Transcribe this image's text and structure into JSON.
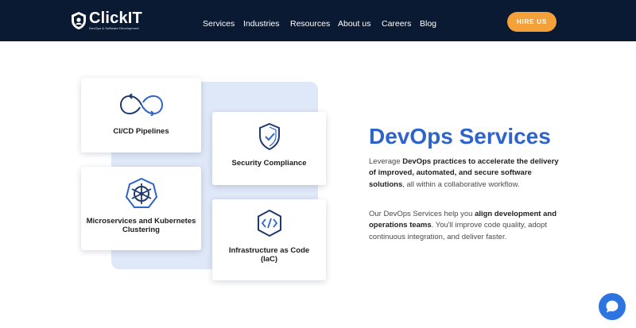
{
  "header": {
    "logo_text": "ClickIT",
    "logo_subtitle": "DevOps & Software Development",
    "nav": [
      "Services",
      "Industries",
      "Resources",
      "About us",
      "Careers",
      "Blog"
    ],
    "hire_label": "HIRE US"
  },
  "cards": [
    {
      "label": "CI/CD Pipelines",
      "icon": "infinity-icon"
    },
    {
      "label": "Security Compliance",
      "icon": "shield-check-icon"
    },
    {
      "label": "Microservices and Kubernetes Clustering",
      "icon": "kubernetes-icon"
    },
    {
      "label": "Infrastructure as Code (IaC)",
      "icon": "code-icon"
    }
  ],
  "main": {
    "title": "DevOps Services",
    "para1": {
      "a": "Leverage ",
      "b": "DevOps practices to accelerate the delivery of improved, automated, and secure software solutions",
      "c": ", all within a collaborative workflow."
    },
    "para2": {
      "a": "Our DevOps Services help you ",
      "b": "align development and operations teams",
      "c": ". You'll improve code quality, adopt continuous integration, and deliver faster."
    }
  },
  "colors": {
    "header_bg": "#0b1a33",
    "accent": "#2e63c9",
    "hire_button": "#f5a13a",
    "chat_button": "#2b74e2"
  }
}
